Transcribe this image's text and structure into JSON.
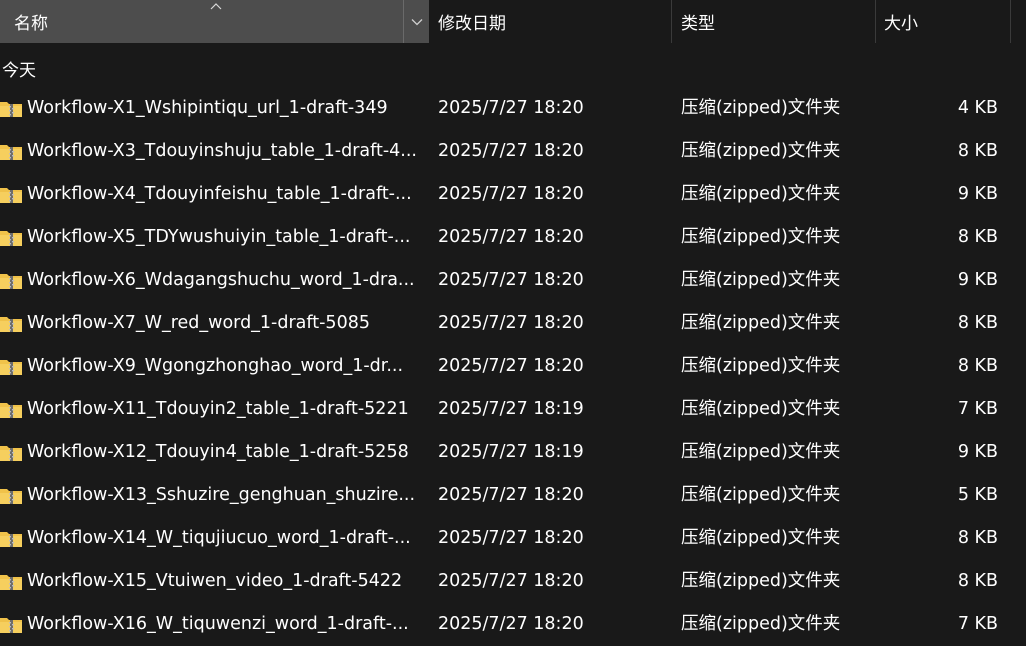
{
  "columns": {
    "name": "名称",
    "date": "修改日期",
    "type": "类型",
    "size": "大小"
  },
  "group_label": "今天",
  "colors": {
    "background": "#191919",
    "header_active": "#4d4d4d",
    "folder_yellow": "#f0c24a",
    "zipper": "#6d6d6d"
  },
  "icons": {
    "sort": "sort-up-arrow-icon",
    "dropdown": "chevron-down-icon",
    "file": "zip-folder-icon"
  },
  "files": [
    {
      "name": "Workflow-X1_Wshipintiqu_url_1-draft-349",
      "date": "2025/7/27 18:20",
      "type": "压缩(zipped)文件夹",
      "size": "4 KB"
    },
    {
      "name": "Workflow-X3_Tdouyinshuju_table_1-draft-4...",
      "date": "2025/7/27 18:20",
      "type": "压缩(zipped)文件夹",
      "size": "8 KB"
    },
    {
      "name": "Workflow-X4_Tdouyinfeishu_table_1-draft-...",
      "date": "2025/7/27 18:20",
      "type": "压缩(zipped)文件夹",
      "size": "9 KB"
    },
    {
      "name": "Workflow-X5_TDYwushuiyin_table_1-draft-...",
      "date": "2025/7/27 18:20",
      "type": "压缩(zipped)文件夹",
      "size": "8 KB"
    },
    {
      "name": "Workflow-X6_Wdagangshuchu_word_1-dra...",
      "date": "2025/7/27 18:20",
      "type": "压缩(zipped)文件夹",
      "size": "9 KB"
    },
    {
      "name": "Workflow-X7_W_red_word_1-draft-5085",
      "date": "2025/7/27 18:20",
      "type": "压缩(zipped)文件夹",
      "size": "8 KB"
    },
    {
      "name": "Workflow-X9_Wgongzhonghao_word_1-dr...",
      "date": "2025/7/27 18:20",
      "type": "压缩(zipped)文件夹",
      "size": "8 KB"
    },
    {
      "name": "Workflow-X11_Tdouyin2_table_1-draft-5221",
      "date": "2025/7/27 18:19",
      "type": "压缩(zipped)文件夹",
      "size": "7 KB"
    },
    {
      "name": "Workflow-X12_Tdouyin4_table_1-draft-5258",
      "date": "2025/7/27 18:19",
      "type": "压缩(zipped)文件夹",
      "size": "9 KB"
    },
    {
      "name": "Workflow-X13_Sshuzire_genghuan_shuzire...",
      "date": "2025/7/27 18:20",
      "type": "压缩(zipped)文件夹",
      "size": "5 KB"
    },
    {
      "name": "Workflow-X14_W_tiqujiucuo_word_1-draft-...",
      "date": "2025/7/27 18:20",
      "type": "压缩(zipped)文件夹",
      "size": "8 KB"
    },
    {
      "name": "Workflow-X15_Vtuiwen_video_1-draft-5422",
      "date": "2025/7/27 18:20",
      "type": "压缩(zipped)文件夹",
      "size": "8 KB"
    },
    {
      "name": "Workflow-X16_W_tiquwenzi_word_1-draft-...",
      "date": "2025/7/27 18:20",
      "type": "压缩(zipped)文件夹",
      "size": "7 KB"
    }
  ]
}
